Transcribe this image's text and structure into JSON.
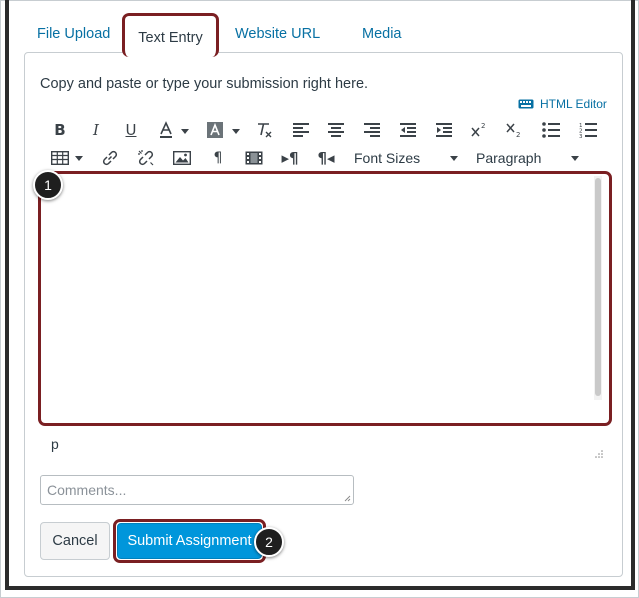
{
  "tabs": [
    {
      "label": "File Upload"
    },
    {
      "label": "Text Entry"
    },
    {
      "label": "Website URL"
    },
    {
      "label": "Media"
    }
  ],
  "instructions": "Copy and paste or type your submission right here.",
  "html_editor_link": "HTML Editor",
  "toolbar": {
    "font_sizes_label": "Font Sizes",
    "paragraph_label": "Paragraph"
  },
  "editor": {
    "path": "p"
  },
  "comments": {
    "placeholder": "Comments..."
  },
  "buttons": {
    "cancel": "Cancel",
    "submit": "Submit Assignment"
  },
  "callouts": [
    "1",
    "2"
  ],
  "colors": {
    "link": "#0770a3",
    "primary": "#0096db",
    "highlight": "#7a1f22"
  }
}
